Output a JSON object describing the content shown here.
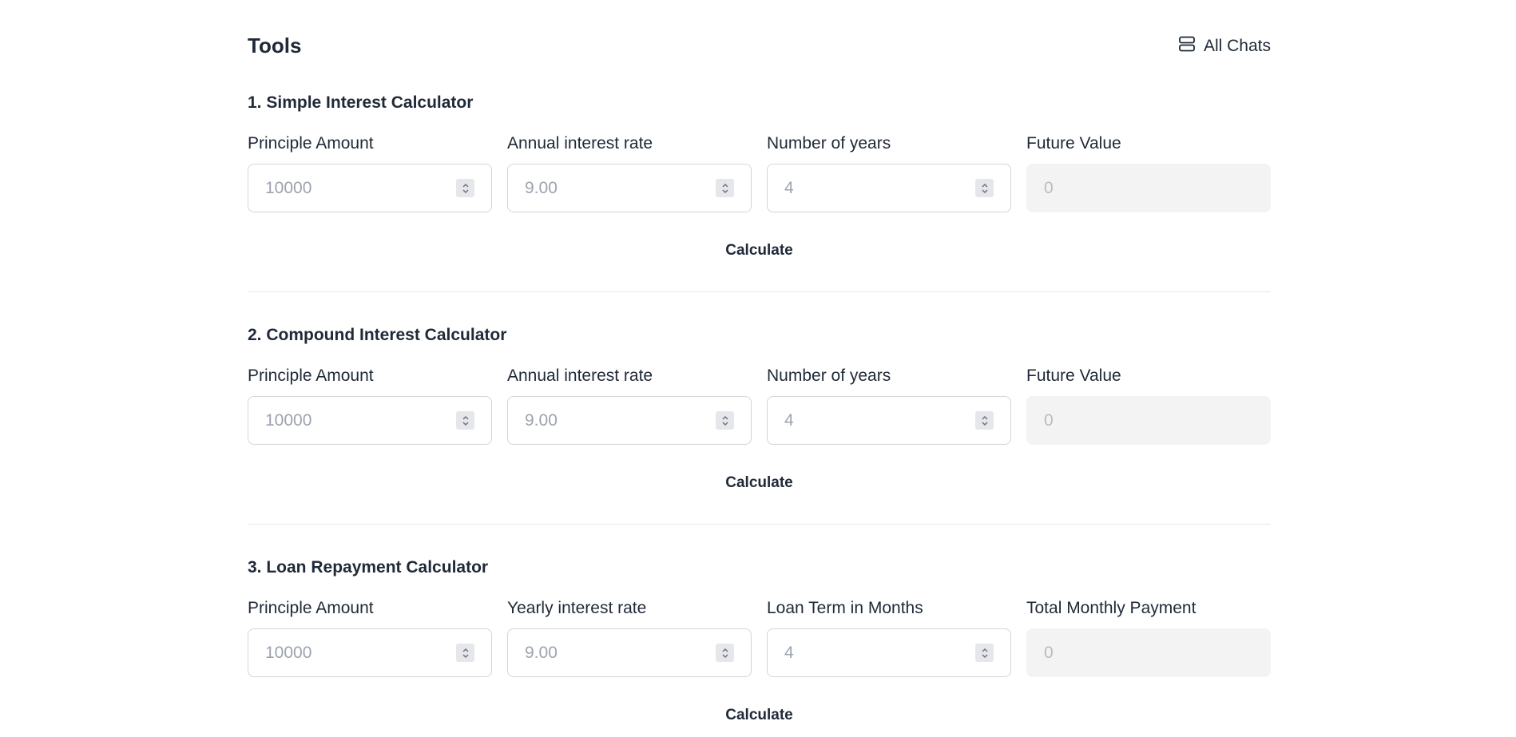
{
  "header": {
    "title": "Tools",
    "all_chats_label": "All Chats",
    "all_chats_icon": "stack-icon"
  },
  "sections": [
    {
      "title": "1. Simple Interest Calculator",
      "fields": [
        {
          "label": "Principle Amount",
          "value": "10000",
          "readonly": false
        },
        {
          "label": "Annual interest rate",
          "value": "9.00",
          "readonly": false
        },
        {
          "label": "Number of years",
          "value": "4",
          "readonly": false
        },
        {
          "label": "Future Value",
          "value": "0",
          "readonly": true
        }
      ],
      "button": "Calculate"
    },
    {
      "title": "2. Compound Interest Calculator",
      "fields": [
        {
          "label": "Principle Amount",
          "value": "10000",
          "readonly": false
        },
        {
          "label": "Annual interest rate",
          "value": "9.00",
          "readonly": false
        },
        {
          "label": "Number of years",
          "value": "4",
          "readonly": false
        },
        {
          "label": "Future Value",
          "value": "0",
          "readonly": true
        }
      ],
      "button": "Calculate"
    },
    {
      "title": "3. Loan Repayment Calculator",
      "fields": [
        {
          "label": "Principle Amount",
          "value": "10000",
          "readonly": false
        },
        {
          "label": "Yearly interest rate",
          "value": "9.00",
          "readonly": false
        },
        {
          "label": "Loan Term in Months",
          "value": "4",
          "readonly": false
        },
        {
          "label": "Total Monthly Payment",
          "value": "0",
          "readonly": true
        }
      ],
      "button": "Calculate"
    }
  ]
}
